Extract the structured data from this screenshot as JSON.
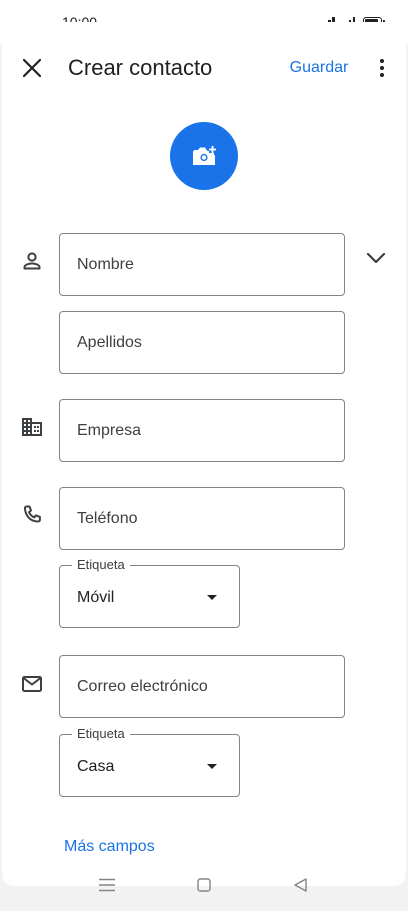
{
  "status": {
    "time": "10:00"
  },
  "header": {
    "title": "Crear contacto",
    "save_label": "Guardar"
  },
  "icons": {
    "close": "close-icon",
    "more": "more-vert-icon",
    "add_photo": "add-photo-icon",
    "person": "person-icon",
    "business": "business-icon",
    "phone": "phone-icon",
    "mail": "mail-icon",
    "expand": "chevron-down-icon"
  },
  "form": {
    "name_placeholder": "Nombre",
    "surname_placeholder": "Apellidos",
    "company_placeholder": "Empresa",
    "phone_placeholder": "Teléfono",
    "phone_label_legend": "Etiqueta",
    "phone_label_value": "Móvil",
    "email_placeholder": "Correo electrónico",
    "email_label_legend": "Etiqueta",
    "email_label_value": "Casa",
    "more_fields": "Más campos"
  },
  "colors": {
    "accent": "#1a73e8",
    "text": "#202124",
    "border": "#80868b"
  }
}
